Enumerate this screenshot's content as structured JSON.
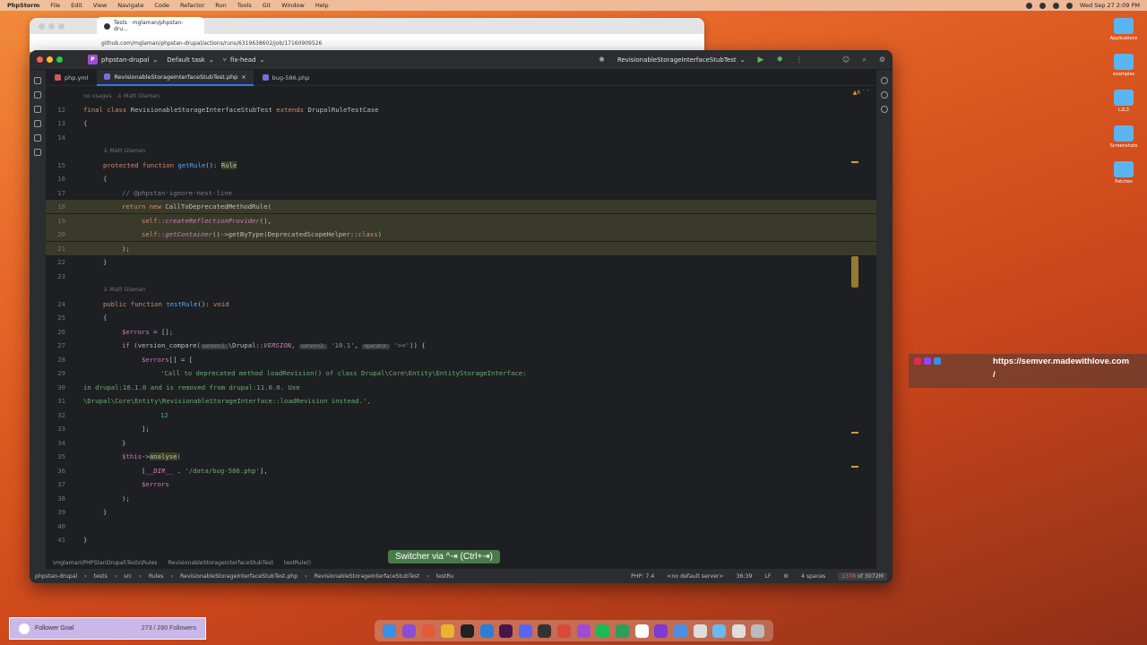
{
  "menubar": {
    "app": "PhpStorm",
    "items": [
      "File",
      "Edit",
      "View",
      "Navigate",
      "Code",
      "Refactor",
      "Run",
      "Tools",
      "Git",
      "Window",
      "Help"
    ],
    "datetime": "Wed Sep 27  2:09 PM"
  },
  "desktop": {
    "icons": [
      "Applications",
      "examples",
      "L2L3",
      "Screenshots",
      "Patches"
    ]
  },
  "browser": {
    "tab_title": "Tests · mglaman/phpstan-dru...",
    "url": "github.com/mglaman/phpstan-drupal/actions/runs/6319638602/job/17160909526"
  },
  "ide": {
    "project": "phpstan-drupal",
    "project_badge": "P",
    "task": "Default task",
    "branch": "fix-head",
    "run_config": "RevisionableStorageInterfaceStubTest",
    "tabs": [
      {
        "label": "php.yml",
        "icon": "yml",
        "active": false
      },
      {
        "label": "RevisionableStorageInterfaceStubTest.php",
        "icon": "php",
        "active": true
      },
      {
        "label": "bug-586.php",
        "icon": "php",
        "active": false
      }
    ],
    "inspections": "6",
    "hint_no_usages": "no usages",
    "hint_author": "Matt Glaman",
    "breadcrumb": [
      "\\mglaman\\PHPStanDrupal\\Tests\\Rules",
      "RevisionableStorageInterfaceStubTest",
      "testRule()"
    ],
    "status": {
      "path": [
        "phpstan-drupal",
        "tests",
        "src",
        "Rules",
        "RevisionableStorageInterfaceStubTest.php",
        "RevisionableStorageInterfaceStubTest",
        "testRu"
      ],
      "php": "PHP: 7.4",
      "server": "<no default server>",
      "position": "36:39",
      "line_ending": "LF",
      "indent": "4 spaces",
      "memory_used": "1378",
      "memory_total": "of 3072M"
    },
    "switcher_hint": "Switcher via ^⇥ (Ctrl+⇥)"
  },
  "code": {
    "l12": {
      "n": "12",
      "t1": "final class",
      "t2": "RevisionableStorageInterfaceStubTest",
      "t3": "extends",
      "t4": "DrupalRuleTestCase"
    },
    "l13": {
      "n": "13",
      "t": "{"
    },
    "l14": {
      "n": "14"
    },
    "l15": {
      "n": "15",
      "t1": "protected function",
      "t2": "getRule",
      "t3": "(): ",
      "t4": "Rule"
    },
    "l16": {
      "n": "16",
      "t": "{"
    },
    "l17": {
      "n": "17",
      "t": "// @phpstan-ignore-next-line"
    },
    "l18": {
      "n": "18",
      "t1": "return new",
      "t2": "CallToDeprecatedMethodRule("
    },
    "l19": {
      "n": "19",
      "t1": "self::",
      "t2": "createReflectionProvider",
      "t3": "(),"
    },
    "l20": {
      "n": "20",
      "t1": "self::",
      "t2": "getContainer",
      "t3": "()->getByType(DeprecatedScopeHelper::",
      "t4": "class",
      "t5": ")"
    },
    "l21": {
      "n": "21",
      "t": ");"
    },
    "l22": {
      "n": "22",
      "t": "}"
    },
    "l23": {
      "n": "23"
    },
    "l24": {
      "n": "24",
      "t1": "public function",
      "t2": "testRule",
      "t3": "(): ",
      "t4": "void"
    },
    "l25": {
      "n": "25",
      "t": "{"
    },
    "l26": {
      "n": "26",
      "t1": "$errors",
      "t2": " = [];"
    },
    "l27": {
      "n": "27",
      "t1": "if",
      "t2": " (version_compare(",
      "p1": "version1:",
      "t3": "\\Drupal::",
      "t4": "VERSION",
      "t5": ",",
      "p2": "version2:",
      "t6": "'10.1'",
      "t7": ",",
      "p3": "operator:",
      "t8": "'>='",
      "t9": ")) {"
    },
    "l28": {
      "n": "28",
      "t1": "$errors",
      "t2": "[] = ["
    },
    "l29": {
      "n": "29",
      "t": "'Call to deprecated method loadRevision() of class Drupal\\Core\\Entity\\EntityStorageInterface:"
    },
    "l30": {
      "n": "30",
      "t": "in drupal:10.1.0 and is removed from drupal:11.0.0. Use"
    },
    "l31": {
      "n": "31",
      "t": "\\Drupal\\Core\\Entity\\RevisionableStorageInterface::loadRevision instead.',"
    },
    "l32": {
      "n": "32",
      "t": "12"
    },
    "l33": {
      "n": "33",
      "t": "];"
    },
    "l34": {
      "n": "34",
      "t": "}"
    },
    "l35": {
      "n": "35",
      "t1": "$this",
      "t2": "->",
      "t3": "analyse",
      "t4": "("
    },
    "l36": {
      "n": "36",
      "t1": "[",
      "t2": "__DIR__",
      "t3": " . ",
      "t4": "'/data/bug-586.php'",
      "t5": "],"
    },
    "l37": {
      "n": "37",
      "t": "$errors"
    },
    "l38": {
      "n": "38",
      "t": ");"
    },
    "l39": {
      "n": "39",
      "t": "}"
    },
    "l40": {
      "n": "40"
    },
    "l41": {
      "n": "41",
      "t": "}"
    }
  },
  "overlay": {
    "url": "https://semver.madewithlove.com",
    "slash": "/"
  },
  "follower_goal": {
    "label": "Follower Goal",
    "count": "273 / 280 Followers"
  },
  "colors": {
    "ide_bg": "#1e1f22",
    "accent": "#3574f0",
    "keyword": "#cf8e6d",
    "string": "#6aab73"
  }
}
